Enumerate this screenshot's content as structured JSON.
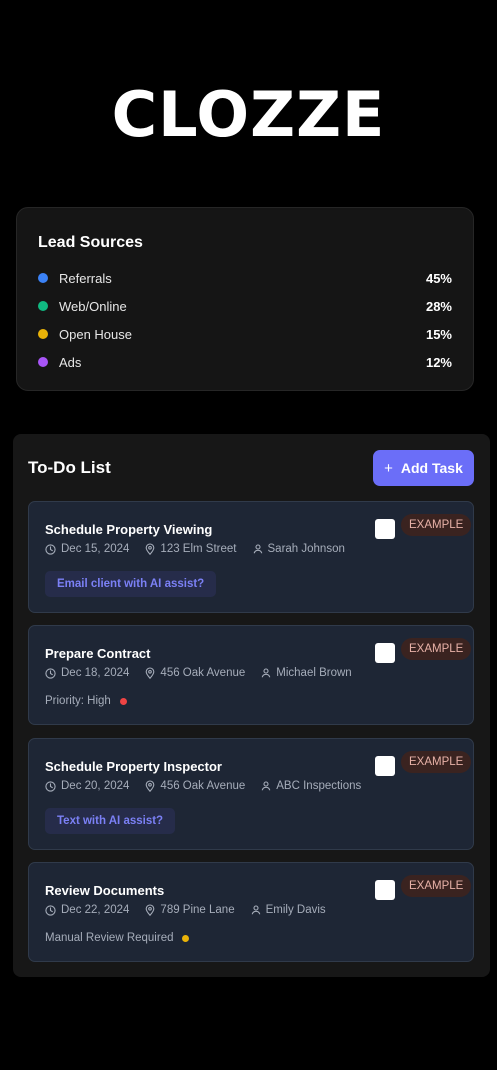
{
  "brand": {
    "logo_text": "CLOZZE"
  },
  "lead_sources": {
    "title": "Lead Sources",
    "items": [
      {
        "label": "Referrals",
        "percent": "45%",
        "color": "#3b82f6"
      },
      {
        "label": "Web/Online",
        "percent": "28%",
        "color": "#10b981"
      },
      {
        "label": "Open House",
        "percent": "15%",
        "color": "#eab308"
      },
      {
        "label": "Ads",
        "percent": "12%",
        "color": "#a855f7"
      }
    ]
  },
  "todo": {
    "title": "To-Do List",
    "add_button": {
      "icon": "plus-icon",
      "label": "Add Task"
    },
    "tasks": [
      {
        "title": "Schedule Property Viewing",
        "date": "Dec 15, 2024",
        "location": "123 Elm Street",
        "contact": "Sarah Johnson",
        "badge": "EXAMPLE",
        "action": "Email client with AI assist?"
      },
      {
        "title": "Prepare Contract",
        "date": "Dec 18, 2024",
        "location": "456 Oak Avenue",
        "contact": "Michael Brown",
        "badge": "EXAMPLE",
        "status": "Priority: High",
        "status_color": "#ef4444"
      },
      {
        "title": "Schedule Property Inspector",
        "date": "Dec 20, 2024",
        "location": "456 Oak Avenue",
        "contact": "ABC Inspections",
        "badge": "EXAMPLE",
        "action": "Text with AI assist?"
      },
      {
        "title": "Review Documents",
        "date": "Dec 22, 2024",
        "location": "789 Pine Lane",
        "contact": "Emily Davis",
        "badge": "EXAMPLE",
        "status": "Manual Review Required",
        "status_color": "#eab308"
      }
    ]
  }
}
